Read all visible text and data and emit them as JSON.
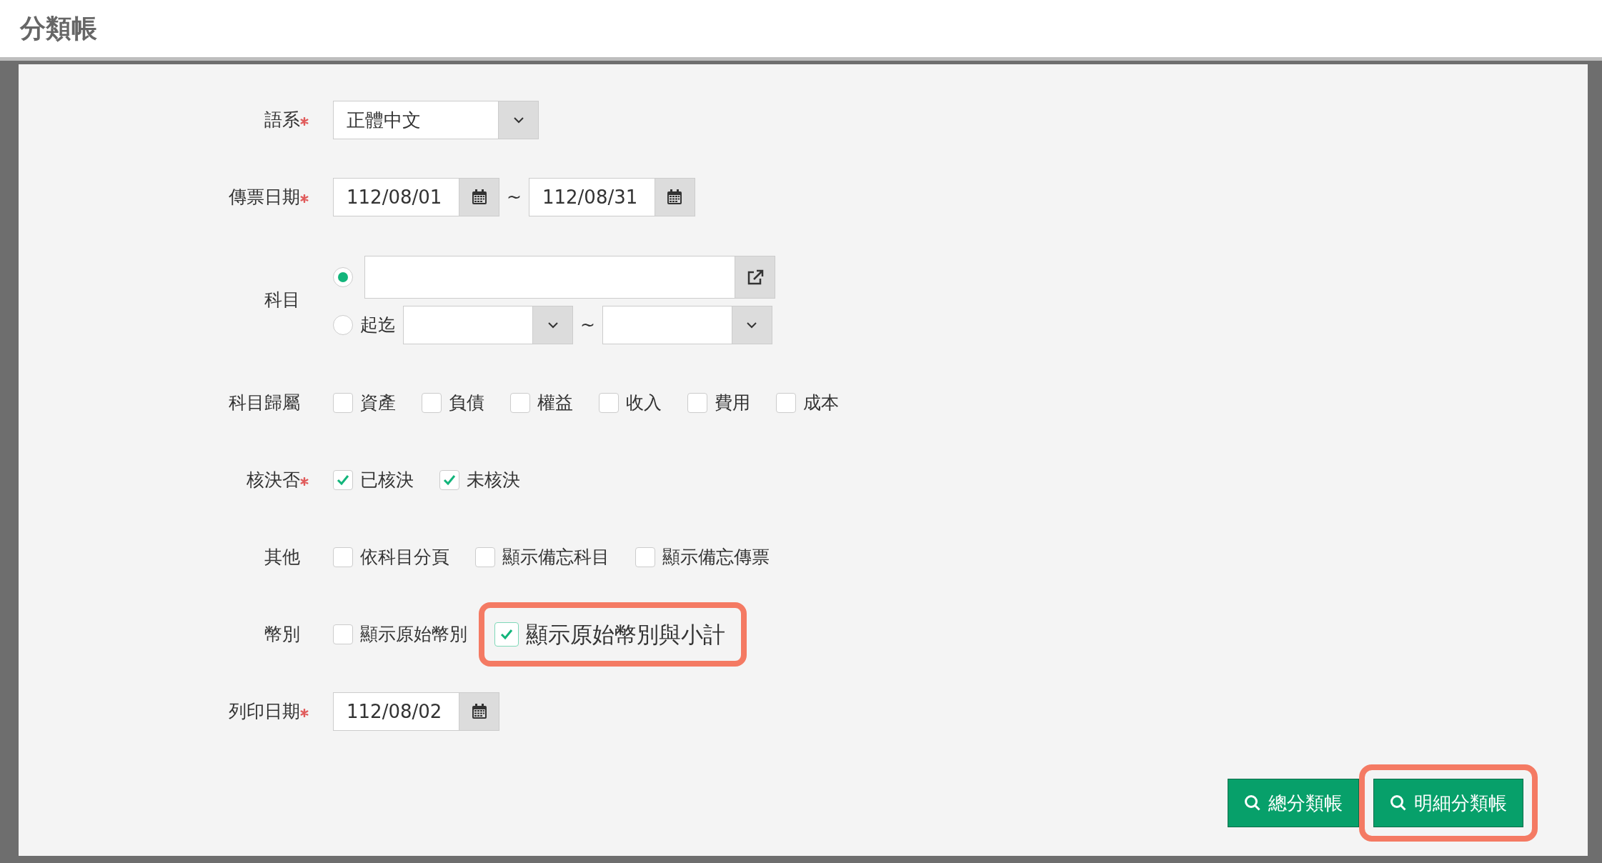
{
  "title": "分類帳",
  "fields": [
    {
      "kind": "select",
      "label": "語系",
      "required": true,
      "value": "正體中文"
    },
    {
      "kind": "date_range",
      "label": "傳票日期",
      "required": true,
      "from": "112/08/01",
      "separator": "~",
      "to": "112/08/31"
    },
    {
      "kind": "account",
      "label": "科目",
      "required": false,
      "options": [
        {
          "selected": true
        },
        {
          "selected": false,
          "label": "起迄",
          "separator": "~"
        }
      ]
    },
    {
      "kind": "checks",
      "label": "科目歸屬",
      "required": false,
      "items": [
        {
          "label": "資產",
          "checked": false,
          "highlighted": false
        },
        {
          "label": "負債",
          "checked": false,
          "highlighted": false
        },
        {
          "label": "權益",
          "checked": false,
          "highlighted": false
        },
        {
          "label": "收入",
          "checked": false,
          "highlighted": false
        },
        {
          "label": "費用",
          "checked": false,
          "highlighted": false
        },
        {
          "label": "成本",
          "checked": false,
          "highlighted": false
        }
      ]
    },
    {
      "kind": "checks",
      "label": "核決否",
      "required": true,
      "items": [
        {
          "label": "已核決",
          "checked": true,
          "highlighted": false
        },
        {
          "label": "未核決",
          "checked": true,
          "highlighted": false
        }
      ]
    },
    {
      "kind": "checks",
      "label": "其他",
      "required": false,
      "items": [
        {
          "label": "依科目分頁",
          "checked": false,
          "highlighted": false
        },
        {
          "label": "顯示備忘科目",
          "checked": false,
          "highlighted": false
        },
        {
          "label": "顯示備忘傳票",
          "checked": false,
          "highlighted": false
        }
      ]
    },
    {
      "kind": "checks",
      "label": "幣別",
      "required": false,
      "items": [
        {
          "label": "顯示原始幣別",
          "checked": false,
          "highlighted": false
        },
        {
          "label": "顯示原始幣別與小計",
          "checked": true,
          "highlighted": true
        }
      ]
    },
    {
      "kind": "date",
      "label": "列印日期",
      "required": true,
      "value": "112/08/02"
    }
  ],
  "buttons": [
    {
      "label": "總分類帳",
      "highlighted": false
    },
    {
      "label": "明細分類帳",
      "highlighted": true
    }
  ]
}
